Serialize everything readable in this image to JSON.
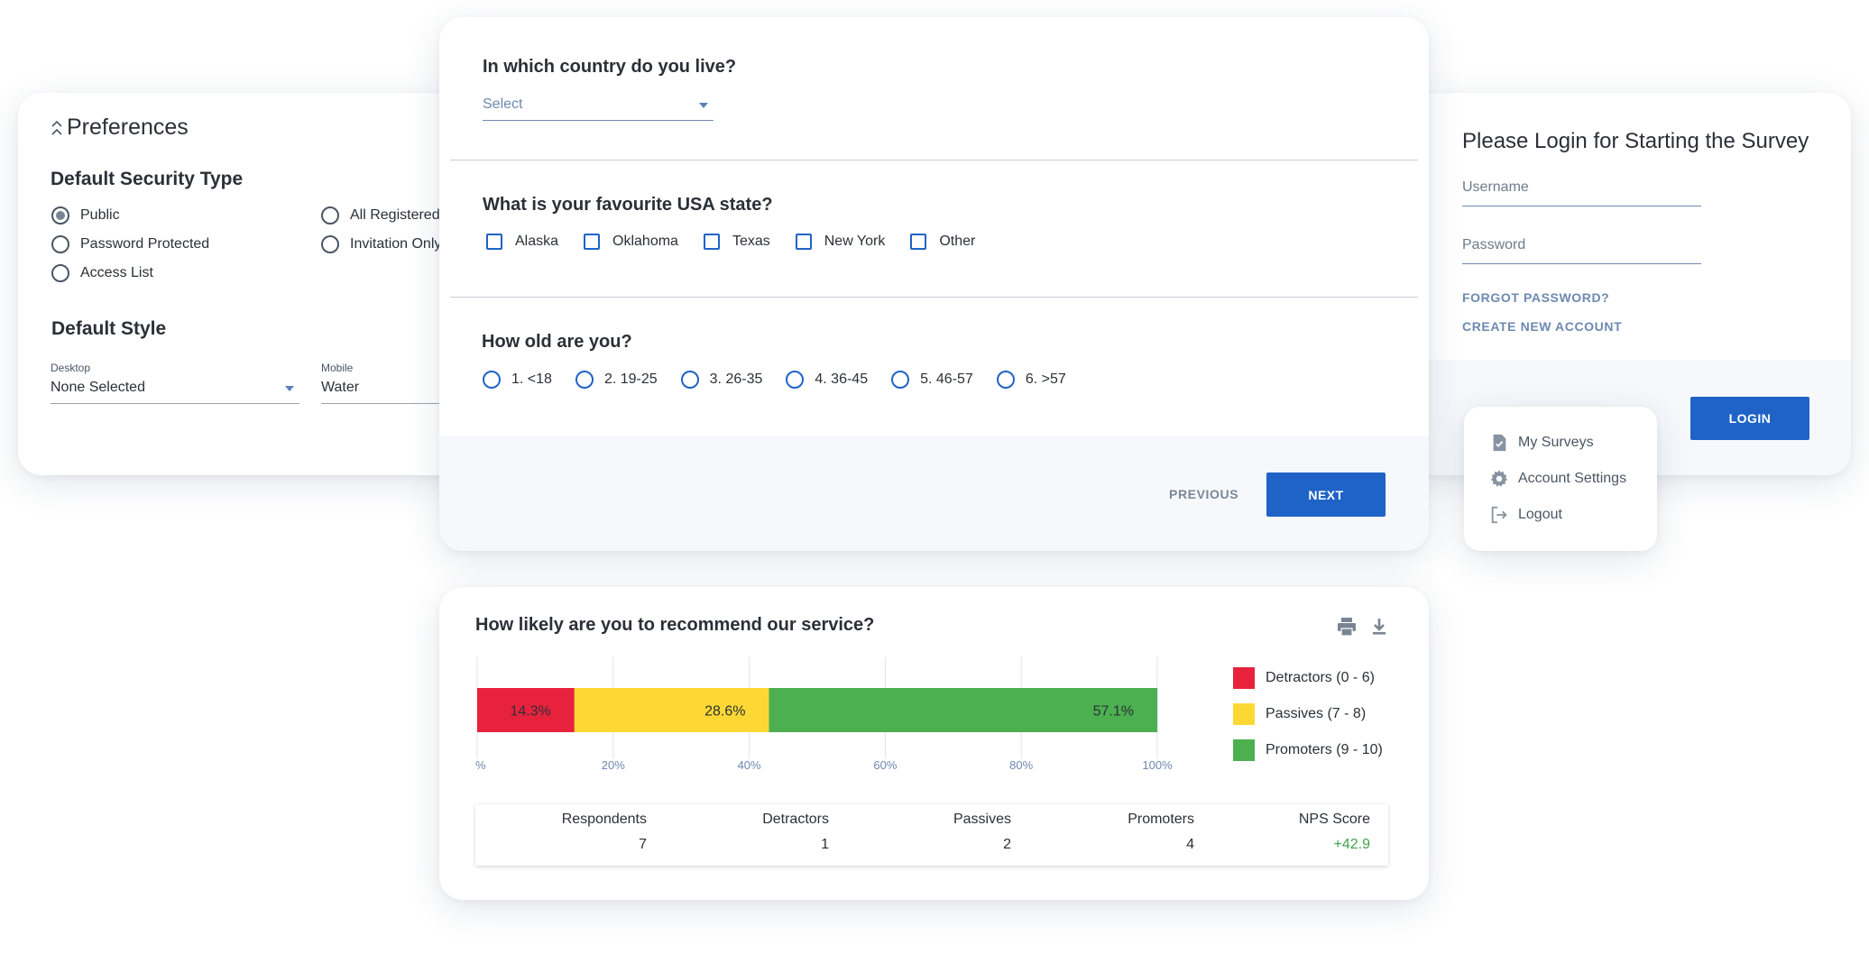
{
  "preferences": {
    "title": "Preferences",
    "security": {
      "heading": "Default Security Type",
      "options": [
        "Public",
        "Password Protected",
        "Access List",
        "All Registered",
        "Invitation Only"
      ],
      "selected": "Public"
    },
    "style": {
      "heading": "Default Style",
      "desktop_label": "Desktop",
      "desktop_value": "None Selected",
      "mobile_label": "Mobile",
      "mobile_value": "Water"
    }
  },
  "survey": {
    "q1": {
      "text": "In which country do you live?",
      "placeholder": "Select"
    },
    "q2": {
      "text": "What is your favourite USA state?",
      "options": [
        "Alaska",
        "Oklahoma",
        "Texas",
        "New York",
        "Other"
      ]
    },
    "q3": {
      "text": "How old are you?",
      "options": [
        "1. <18",
        "2. 19-25",
        "3. 26-35",
        "4. 36-45",
        "5. 46-57",
        "6. >57"
      ]
    },
    "previous_label": "PREVIOUS",
    "next_label": "NEXT"
  },
  "login": {
    "title": "Please Login for Starting the Survey",
    "username_placeholder": "Username",
    "password_placeholder": "Password",
    "forgot_label": "FORGOT PASSWORD?",
    "create_label": "CREATE NEW ACCOUNT",
    "login_label": "LOGIN"
  },
  "menu": {
    "items": [
      {
        "label": "My Surveys",
        "icon": "survey-check-icon"
      },
      {
        "label": "Account Settings",
        "icon": "gear-icon"
      },
      {
        "label": "Logout",
        "icon": "logout-icon"
      }
    ]
  },
  "nps": {
    "title": "How likely are you to recommend our service?",
    "icons": [
      "print-icon",
      "download-icon"
    ],
    "stats": {
      "headers": [
        "Respondents",
        "Detractors",
        "Passives",
        "Promoters",
        "NPS Score"
      ],
      "values": [
        "7",
        "1",
        "2",
        "4",
        "+42.9"
      ]
    },
    "score_color": "#3fa34d"
  },
  "chart_data": {
    "type": "bar",
    "orientation": "horizontal-stacked",
    "series": [
      {
        "name": "Detractors (0 - 6)",
        "value": 14.3,
        "label": "14.3%",
        "color": "#e8223c"
      },
      {
        "name": "Passives (7 - 8)",
        "value": 28.6,
        "label": "28.6%",
        "color": "#fdd835"
      },
      {
        "name": "Promoters (9 - 10)",
        "value": 57.1,
        "label": "57.1%",
        "color": "#4caf50"
      }
    ],
    "x_ticks": [
      "%",
      "20%",
      "40%",
      "60%",
      "80%",
      "100%"
    ],
    "xlim": [
      0,
      100
    ],
    "grid": true,
    "legend_position": "right"
  }
}
